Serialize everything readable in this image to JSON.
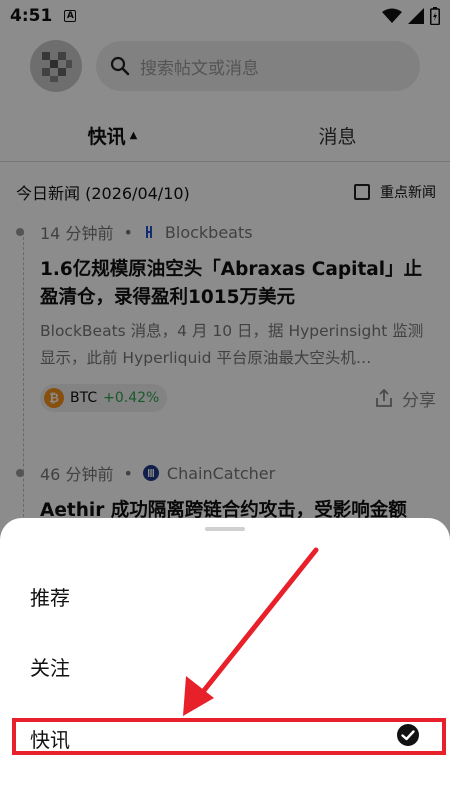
{
  "status_bar": {
    "time": "4:51",
    "badge": "A"
  },
  "header": {
    "search_placeholder": "搜索帖文或消息"
  },
  "tabs": [
    {
      "label": "快讯",
      "active": true
    },
    {
      "label": "消息",
      "active": false
    }
  ],
  "feed": {
    "date_heading": "今日新闻 (2026/04/10)",
    "important_toggle": "重点新闻",
    "items": [
      {
        "time": "14 分钟前",
        "separator": "•",
        "source": "Blockbeats",
        "title": "1.6亿规模原油空头「Abraxas Capital」止盈清仓，录得盈利1015万美元",
        "desc": "BlockBeats 消息，4 月 10 日，据 Hyperinsight 监测显示，此前 Hyperliquid 平台原油最大空头机…",
        "coin": "BTC",
        "coin_change": "+0.42%",
        "share": "分享"
      },
      {
        "time": "46 分钟前",
        "separator": "•",
        "source": "ChainCatcher",
        "title": "Aethir 成功隔离跨链合约攻击，受影响金额"
      }
    ]
  },
  "sheet": {
    "items": [
      {
        "label": "推荐",
        "selected": false
      },
      {
        "label": "关注",
        "selected": false
      },
      {
        "label": "快讯",
        "selected": true
      }
    ]
  },
  "colors": {
    "highlight": "#e8202a",
    "positive": "#2ea44f",
    "btc": "#f7931a"
  }
}
